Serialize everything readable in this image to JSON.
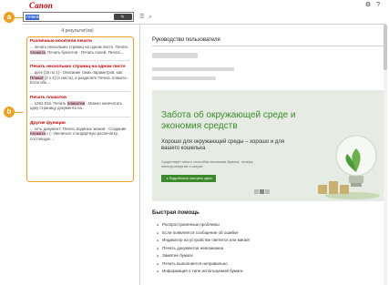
{
  "app": {
    "logo": "Canon",
    "top_icons": {
      "settings": "⚙",
      "help": "?"
    }
  },
  "search": {
    "value": "плакат",
    "button_icon": "🔍"
  },
  "header_icons": {
    "menu": "☰",
    "search": "⌕"
  },
  "results": {
    "count_label": "4 результат(ов)",
    "items": [
      {
        "title": "Различные носители печати",
        "snippet_pre": "... печать нескольких страниц на одном листе. Печать ",
        "highlight": "плаката",
        "snippet_post": ". Печать буклетов - Печать полей. Печать..."
      },
      {
        "title": "Печать нескольких страниц на одном листе",
        "snippet_pre": "... дите [16 по 1] - Описание таких параметров, как: ",
        "highlight": "Плакат",
        "snippet_post": " [2 x 2] (4 листа), и разделите Печать плаката - Если объ..."
      },
      {
        "title": "Печать плакатов",
        "snippet_pre": "... 1291-016. Печать ",
        "highlight": "плакатов",
        "snippet_post": " - Можно напечатать одну страницу документа на..."
      },
      {
        "title": "Другие функции",
        "snippet_pre": "... сеть документ: Печать водяных знаков - Создание ",
        "highlight": "плаката",
        "snippet_post": " с (- Увеличьте стандартную распечатку, состоящую ..."
      }
    ]
  },
  "callouts": {
    "a": "a",
    "b": "b"
  },
  "content": {
    "page_title": "Руководство пользователя",
    "banner": {
      "headline": "Забота об окружающей среде и экономия средств",
      "subheadline": "Хорошо для окружающей среды – хорошо и для вашего кошелька",
      "description": "Существует много способов экономии бумаги, тонера, электроэнергии и затрат.",
      "button": "▸ Подробности смотреть здесь",
      "pager": [
        "‹",
        "›"
      ]
    },
    "quick_help": {
      "title": "Быстрая помощь",
      "items": [
        "Распространенные проблемы",
        "Если появляется сообщение об ошибке",
        "Индикатор на устройстве светится или мигает",
        "Печать документов невозможна",
        "Замятие бумаги",
        "Печать выполняется неправильно",
        "Информация о типе используемой бумаги"
      ]
    }
  },
  "colors": {
    "accent": "#f0a020",
    "brand": "#cc0000",
    "banner_green": "#3a8a2a"
  }
}
